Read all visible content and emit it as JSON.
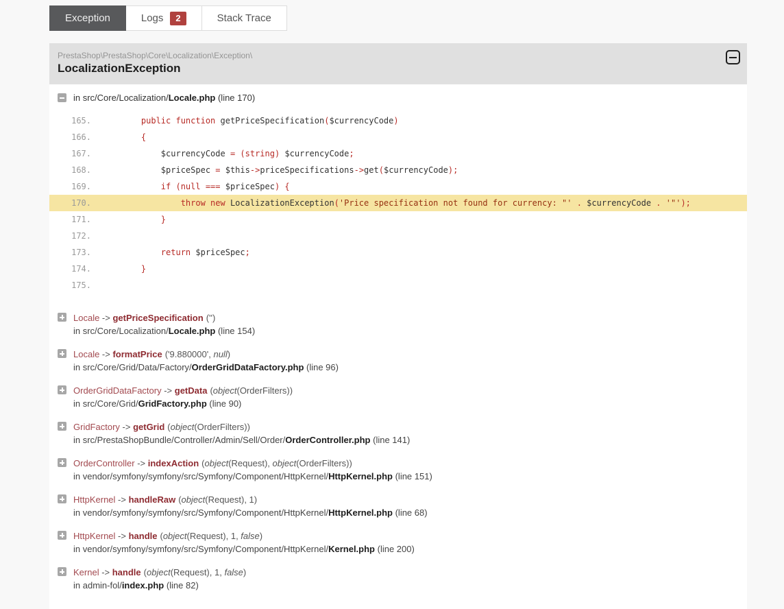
{
  "colors": {
    "page_bg": "#f8f8f8",
    "active_tab_bg": "#58595b",
    "badge_red": "#b0413e",
    "header_gray": "#e0e0e0",
    "highlight_yellow": "#f6e5a2",
    "keyword_red": "#b72a25",
    "string_red": "#963111",
    "trace_class_red": "#a2494f",
    "trace_method_red": "#8e2b31"
  },
  "tabs": {
    "items": [
      {
        "label": "Exception",
        "active": true,
        "badge": null
      },
      {
        "label": "Logs",
        "active": false,
        "badge": "2"
      },
      {
        "label": "Stack Trace",
        "active": false,
        "badge": null
      }
    ]
  },
  "exception": {
    "namespace": "PrestaShop\\PrestaShop\\Core\\Localization\\Exception\\",
    "class_name": "LocalizationException",
    "collapse_icon": "minus-in-rounded-square-icon"
  },
  "source": {
    "toggle_icon": "minus-toggle-icon",
    "prefix_path": "in src/Core/Localization/",
    "file": "Locale.php",
    "line_info": " (line 170)",
    "code_lines": [
      {
        "num": "165.",
        "hl": false,
        "tokens": [
          [
            "k",
            "    public function "
          ],
          [
            "d",
            "getPriceSpecification"
          ],
          [
            "k",
            "("
          ],
          [
            "d",
            "$currencyCode"
          ],
          [
            "k",
            ")"
          ]
        ]
      },
      {
        "num": "166.",
        "hl": false,
        "tokens": [
          [
            "k",
            "    {"
          ]
        ]
      },
      {
        "num": "167.",
        "hl": false,
        "tokens": [
          [
            "d",
            "        $currencyCode "
          ],
          [
            "k",
            "= (string) "
          ],
          [
            "d",
            "$currencyCode"
          ],
          [
            "k",
            ";"
          ]
        ]
      },
      {
        "num": "168.",
        "hl": false,
        "tokens": [
          [
            "d",
            "        $priceSpec "
          ],
          [
            "k",
            "= "
          ],
          [
            "d",
            "$this"
          ],
          [
            "k",
            "->"
          ],
          [
            "d",
            "priceSpecifications"
          ],
          [
            "k",
            "->"
          ],
          [
            "d",
            "get"
          ],
          [
            "k",
            "("
          ],
          [
            "d",
            "$currencyCode"
          ],
          [
            "k",
            ");"
          ]
        ]
      },
      {
        "num": "169.",
        "hl": false,
        "tokens": [
          [
            "k",
            "        if (null === "
          ],
          [
            "d",
            "$priceSpec"
          ],
          [
            "k",
            ") {"
          ]
        ]
      },
      {
        "num": "170.",
        "hl": true,
        "tokens": [
          [
            "k",
            "            throw new "
          ],
          [
            "d",
            "LocalizationException"
          ],
          [
            "k",
            "("
          ],
          [
            "s",
            "'Price specification not found for currency: \"'"
          ],
          [
            "k",
            " . "
          ],
          [
            "d",
            "$currencyCode"
          ],
          [
            "k",
            " . "
          ],
          [
            "s",
            "'\"'"
          ],
          [
            "k",
            ");"
          ]
        ]
      },
      {
        "num": "171.",
        "hl": false,
        "tokens": [
          [
            "k",
            "        }"
          ]
        ]
      },
      {
        "num": "172.",
        "hl": false,
        "tokens": []
      },
      {
        "num": "173.",
        "hl": false,
        "tokens": [
          [
            "k",
            "        return "
          ],
          [
            "d",
            "$priceSpec"
          ],
          [
            "k",
            ";"
          ]
        ]
      },
      {
        "num": "174.",
        "hl": false,
        "tokens": [
          [
            "k",
            "    }"
          ]
        ]
      },
      {
        "num": "175.",
        "hl": false,
        "tokens": []
      }
    ]
  },
  "trace": {
    "arrow": " -> ",
    "entries": [
      {
        "class": "Locale",
        "method": "getPriceSpecification",
        "args": [
          [
            0,
            "('')"
          ]
        ],
        "path_prefix": "in src/Core/Localization/",
        "file": "Locale.php",
        "line_info": " (line 154)"
      },
      {
        "class": "Locale",
        "method": "formatPrice",
        "args": [
          [
            0,
            "('9.880000', "
          ],
          [
            1,
            "null"
          ],
          [
            0,
            ")"
          ]
        ],
        "path_prefix": "in src/Core/Grid/Data/Factory/",
        "file": "OrderGridDataFactory.php",
        "line_info": " (line 96)"
      },
      {
        "class": "OrderGridDataFactory",
        "method": "getData",
        "args": [
          [
            0,
            "("
          ],
          [
            1,
            "object"
          ],
          [
            0,
            "(OrderFilters))"
          ]
        ],
        "path_prefix": "in src/Core/Grid/",
        "file": "GridFactory.php",
        "line_info": " (line 90)"
      },
      {
        "class": "GridFactory",
        "method": "getGrid",
        "args": [
          [
            0,
            "("
          ],
          [
            1,
            "object"
          ],
          [
            0,
            "(OrderFilters))"
          ]
        ],
        "path_prefix": "in src/PrestaShopBundle/Controller/Admin/Sell/Order/",
        "file": "OrderController.php",
        "line_info": " (line 141)"
      },
      {
        "class": "OrderController",
        "method": "indexAction",
        "args": [
          [
            0,
            "("
          ],
          [
            1,
            "object"
          ],
          [
            0,
            "(Request), "
          ],
          [
            1,
            "object"
          ],
          [
            0,
            "(OrderFilters))"
          ]
        ],
        "path_prefix": "in vendor/symfony/symfony/src/Symfony/Component/HttpKernel/",
        "file": "HttpKernel.php",
        "line_info": " (line 151)"
      },
      {
        "class": "HttpKernel",
        "method": "handleRaw",
        "args": [
          [
            0,
            "("
          ],
          [
            1,
            "object"
          ],
          [
            0,
            "(Request), 1)"
          ]
        ],
        "path_prefix": "in vendor/symfony/symfony/src/Symfony/Component/HttpKernel/",
        "file": "HttpKernel.php",
        "line_info": " (line 68)"
      },
      {
        "class": "HttpKernel",
        "method": "handle",
        "args": [
          [
            0,
            "("
          ],
          [
            1,
            "object"
          ],
          [
            0,
            "(Request), 1, "
          ],
          [
            1,
            "false"
          ],
          [
            0,
            ")"
          ]
        ],
        "path_prefix": "in vendor/symfony/symfony/src/Symfony/Component/HttpKernel/",
        "file": "Kernel.php",
        "line_info": " (line 200)"
      },
      {
        "class": "Kernel",
        "method": "handle",
        "args": [
          [
            0,
            "("
          ],
          [
            1,
            "object"
          ],
          [
            0,
            "(Request), 1, "
          ],
          [
            1,
            "false"
          ],
          [
            0,
            ")"
          ]
        ],
        "path_prefix": "in admin-fol/",
        "file": "index.php",
        "line_info": " (line 82)"
      }
    ]
  }
}
